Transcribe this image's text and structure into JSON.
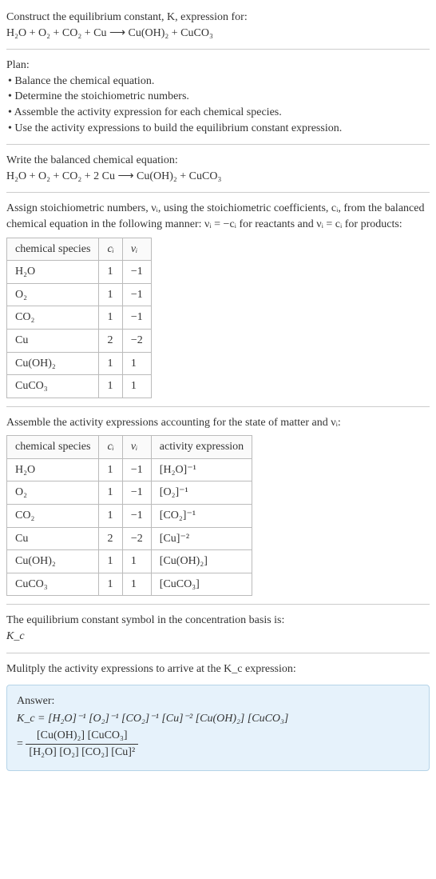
{
  "header": {
    "title_line1": "Construct the equilibrium constant, K, expression for:",
    "equation_unbalanced": "H₂O + O₂ + CO₂ + Cu  ⟶  Cu(OH)₂ + CuCO₃"
  },
  "plan": {
    "heading": "Plan:",
    "items": [
      "Balance the chemical equation.",
      "Determine the stoichiometric numbers.",
      "Assemble the activity expression for each chemical species.",
      "Use the activity expressions to build the equilibrium constant expression."
    ]
  },
  "balanced": {
    "heading": "Write the balanced chemical equation:",
    "equation": "H₂O + O₂ + CO₂ + 2 Cu  ⟶  Cu(OH)₂ + CuCO₃"
  },
  "stoich": {
    "intro_1": "Assign stoichiometric numbers, νᵢ, using the stoichiometric coefficients, cᵢ, from the balanced chemical equation in the following manner: νᵢ = −cᵢ for reactants and νᵢ = cᵢ for products:",
    "headers": {
      "species": "chemical species",
      "c": "cᵢ",
      "v": "νᵢ"
    },
    "rows": [
      {
        "species": "H₂O",
        "c": "1",
        "v": "−1"
      },
      {
        "species": "O₂",
        "c": "1",
        "v": "−1"
      },
      {
        "species": "CO₂",
        "c": "1",
        "v": "−1"
      },
      {
        "species": "Cu",
        "c": "2",
        "v": "−2"
      },
      {
        "species": "Cu(OH)₂",
        "c": "1",
        "v": "1"
      },
      {
        "species": "CuCO₃",
        "c": "1",
        "v": "1"
      }
    ]
  },
  "activity": {
    "intro": "Assemble the activity expressions accounting for the state of matter and νᵢ:",
    "headers": {
      "species": "chemical species",
      "c": "cᵢ",
      "v": "νᵢ",
      "expr": "activity expression"
    },
    "rows": [
      {
        "species": "H₂O",
        "c": "1",
        "v": "−1",
        "expr": "[H₂O]⁻¹"
      },
      {
        "species": "O₂",
        "c": "1",
        "v": "−1",
        "expr": "[O₂]⁻¹"
      },
      {
        "species": "CO₂",
        "c": "1",
        "v": "−1",
        "expr": "[CO₂]⁻¹"
      },
      {
        "species": "Cu",
        "c": "2",
        "v": "−2",
        "expr": "[Cu]⁻²"
      },
      {
        "species": "Cu(OH)₂",
        "c": "1",
        "v": "1",
        "expr": "[Cu(OH)₂]"
      },
      {
        "species": "CuCO₃",
        "c": "1",
        "v": "1",
        "expr": "[CuCO₃]"
      }
    ]
  },
  "kc_symbol": {
    "line": "The equilibrium constant symbol in the concentration basis is:",
    "symbol": "K_c"
  },
  "multiply": {
    "line": "Mulitply the activity expressions to arrive at the K_c expression:"
  },
  "answer": {
    "label": "Answer:",
    "line1": "K_c = [H₂O]⁻¹ [O₂]⁻¹ [CO₂]⁻¹ [Cu]⁻² [Cu(OH)₂] [CuCO₃]",
    "line2_prefix": "= ",
    "frac_num": "[Cu(OH)₂] [CuCO₃]",
    "frac_den": "[H₂O] [O₂] [CO₂] [Cu]²"
  },
  "chart_data": {
    "type": "table",
    "tables": [
      {
        "title": "Stoichiometric numbers",
        "columns": [
          "chemical species",
          "cᵢ",
          "νᵢ"
        ],
        "rows": [
          [
            "H₂O",
            1,
            -1
          ],
          [
            "O₂",
            1,
            -1
          ],
          [
            "CO₂",
            1,
            -1
          ],
          [
            "Cu",
            2,
            -2
          ],
          [
            "Cu(OH)₂",
            1,
            1
          ],
          [
            "CuCO₃",
            1,
            1
          ]
        ]
      },
      {
        "title": "Activity expressions",
        "columns": [
          "chemical species",
          "cᵢ",
          "νᵢ",
          "activity expression"
        ],
        "rows": [
          [
            "H₂O",
            1,
            -1,
            "[H₂O]^-1"
          ],
          [
            "O₂",
            1,
            -1,
            "[O₂]^-1"
          ],
          [
            "CO₂",
            1,
            -1,
            "[CO₂]^-1"
          ],
          [
            "Cu",
            2,
            -2,
            "[Cu]^-2"
          ],
          [
            "Cu(OH)₂",
            1,
            1,
            "[Cu(OH)₂]"
          ],
          [
            "CuCO₃",
            1,
            1,
            "[CuCO₃]"
          ]
        ]
      }
    ]
  }
}
